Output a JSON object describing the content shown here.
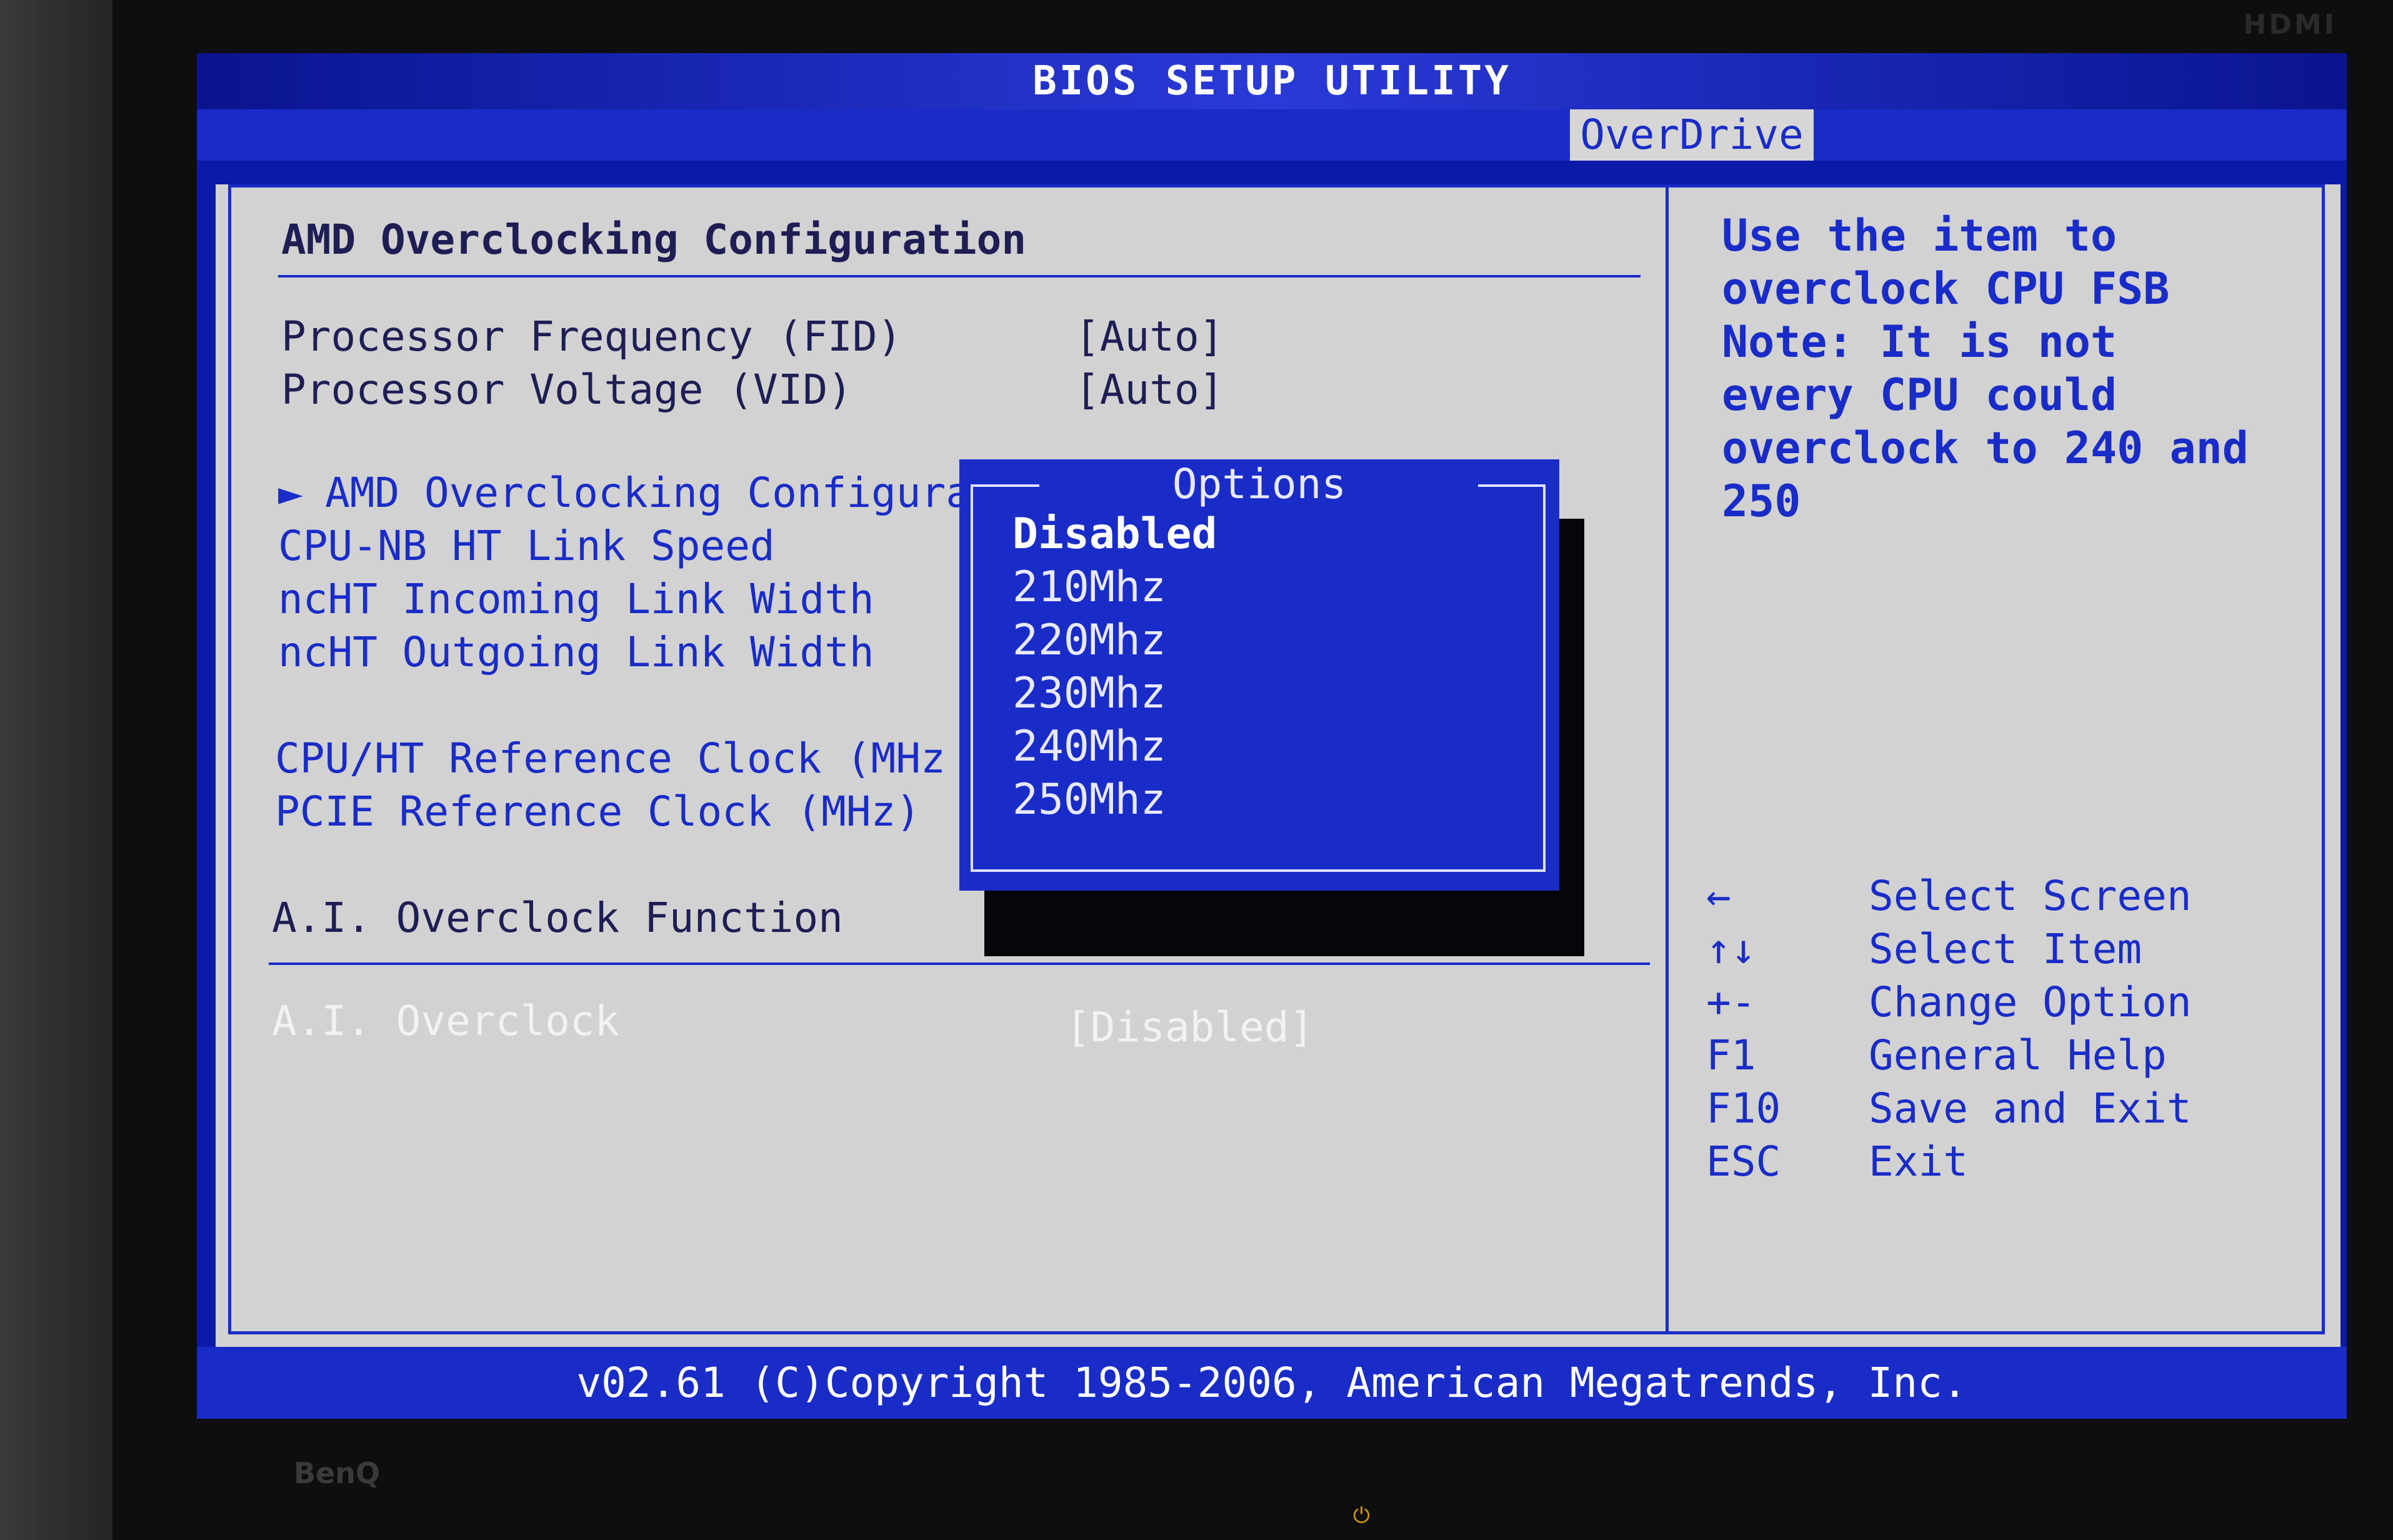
{
  "title": "BIOS SETUP UTILITY",
  "active_tab": "OverDrive",
  "section_header": "AMD Overclocking Configuration",
  "items": [
    {
      "label": "Processor Frequency (FID)",
      "value": "[Auto]"
    },
    {
      "label": "Processor Voltage (VID)",
      "value": "[Auto]"
    }
  ],
  "submenu": {
    "arrow": "►",
    "label": "AMD Overclocking Configuration"
  },
  "links": [
    "CPU-NB HT Link Speed",
    "ncHT Incoming Link Width",
    "ncHT Outgoing Link Width"
  ],
  "clock_items": [
    "CPU/HT Reference Clock (MHz",
    "PCIE Reference Clock (MHz)"
  ],
  "ai_function": "A.I. Overclock Function",
  "ai_overclock": {
    "label": "A.I. Overclock",
    "value": "[Disabled]"
  },
  "popup": {
    "title": "Options",
    "options": [
      "Disabled",
      "210Mhz",
      "220Mhz",
      "230Mhz",
      "240Mhz",
      "250Mhz"
    ],
    "selected_index": 0
  },
  "help_text": "Use the item to\noverclock CPU FSB\nNote: It is not\nevery CPU could\noverclock to 240 and\n250",
  "keys": [
    {
      "key": "←",
      "action": "Select Screen"
    },
    {
      "key": "↑↓",
      "action": "Select Item"
    },
    {
      "key": "+-",
      "action": "Change Option"
    },
    {
      "key": "F1",
      "action": "General Help"
    },
    {
      "key": "F10",
      "action": "Save and Exit"
    },
    {
      "key": "ESC",
      "action": "Exit"
    }
  ],
  "footer": "v02.61 (C)Copyright 1985-2006, American Megatrends, Inc.",
  "bezel": {
    "brand": "BenQ",
    "port_label": "HDMI",
    "power_icon": "power-icon"
  },
  "colors": {
    "bios_blue": "#1a2cc8",
    "panel_grey": "#d2d2d2",
    "text_dark": "#1e1e55"
  }
}
